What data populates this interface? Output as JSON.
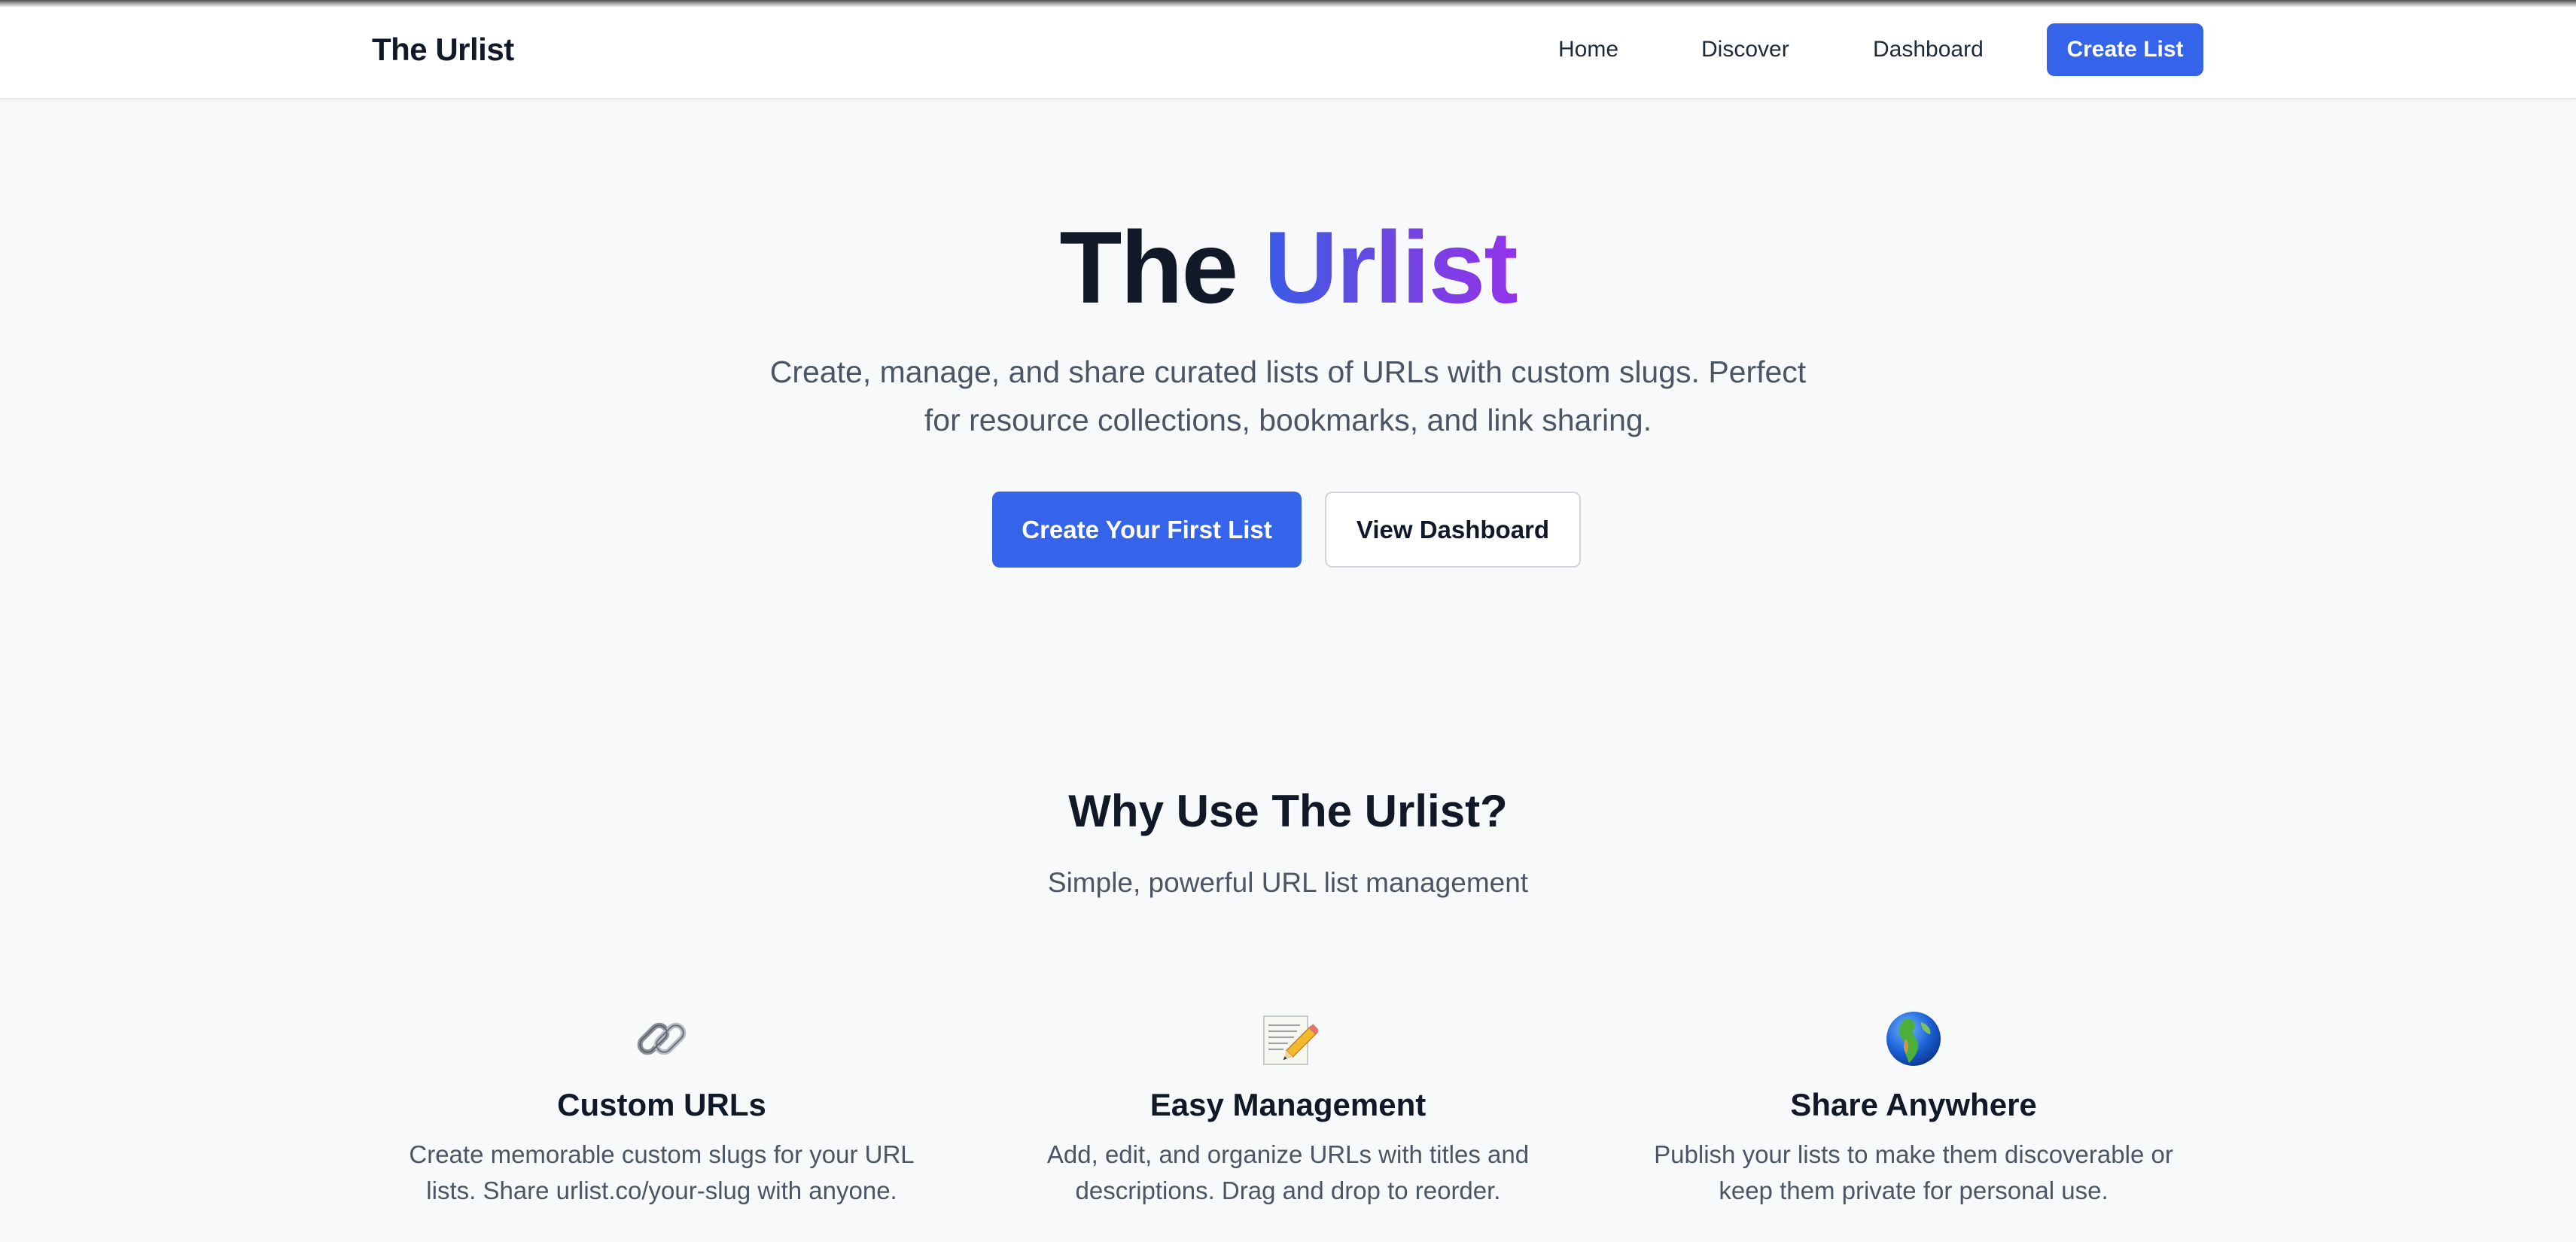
{
  "nav": {
    "brand": "The Urlist",
    "links": [
      "Home",
      "Discover",
      "Dashboard"
    ],
    "cta": "Create List",
    "accent_color": "#3563e9"
  },
  "hero": {
    "title_part1": "The",
    "title_part2": "Urlist",
    "subtitle": "Create, manage, and share curated lists of URLs with custom slugs. Perfect for resource collections, bookmarks, and link sharing.",
    "primary_button": "Create Your First List",
    "secondary_button": "View Dashboard",
    "gradient_colors": [
      "#3b5be6",
      "#9333ea"
    ]
  },
  "why": {
    "title": "Why Use The Urlist?",
    "subtitle": "Simple, powerful URL list management"
  },
  "features": [
    {
      "icon": "link-icon",
      "title": "Custom URLs",
      "description": "Create memorable custom slugs for your URL lists. Share urlist.co/your-slug with anyone."
    },
    {
      "icon": "memo-icon",
      "title": "Easy Management",
      "description": "Add, edit, and organize URLs with titles and descriptions. Drag and drop to reorder."
    },
    {
      "icon": "globe-icon",
      "title": "Share Anywhere",
      "description": "Publish your lists to make them discoverable or keep them private for personal use."
    }
  ]
}
